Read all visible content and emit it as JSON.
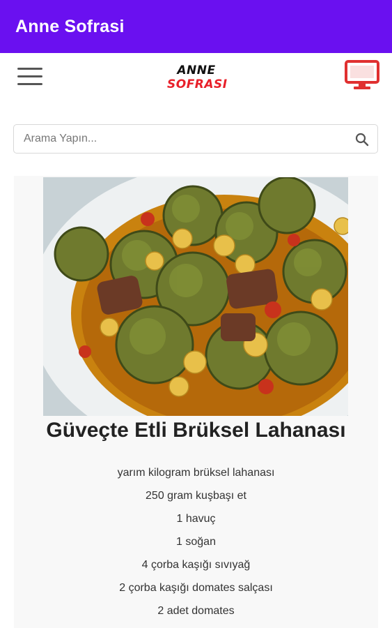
{
  "appbar": {
    "title": "Anne Sofrasi"
  },
  "navbar": {
    "menu_icon": "hamburger-menu-icon",
    "logo": {
      "line1": "ANNE",
      "line2": "SOFRASI"
    },
    "right_icon": "desktop-monitor-icon"
  },
  "search": {
    "placeholder": "Arama Yapın...",
    "value": "",
    "icon": "search-icon"
  },
  "recipe": {
    "title": "Güveçte Etli Brüksel Lahanası",
    "ingredients": [
      "yarım kilogram brüksel lahanası",
      "250 gram kuşbaşı et",
      "1 havuç",
      "1 soğan",
      "4 çorba kaşığı sıvıyağ",
      "2 çorba kaşığı domates salçası",
      "2 adet domates"
    ]
  },
  "colors": {
    "appbar": "#6a10f0",
    "logo_accent": "#e8202a",
    "monitor_icon": "#e03030"
  }
}
